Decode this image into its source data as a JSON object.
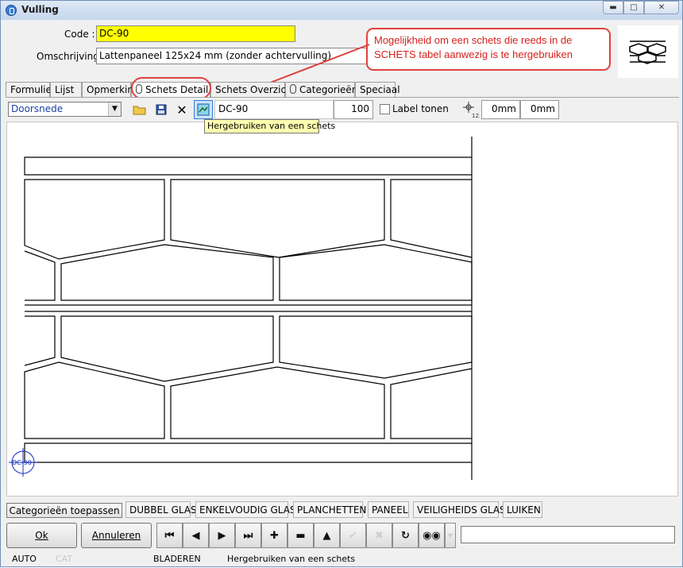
{
  "window": {
    "title": "Vulling"
  },
  "form": {
    "code_label": "Code :",
    "code_value": "DC-90",
    "omschrijving_label": "Omschrijving :",
    "omschrijving_value": "Lattenpaneel 125x24 mm (zonder achtervulling)"
  },
  "callout": {
    "text": "Mogelijkheid om een schets die reeds in de SCHETS tabel aanwezig is te hergebruiken"
  },
  "tabs": [
    {
      "label": "Formulier",
      "icon": ""
    },
    {
      "label": "Lijst",
      "icon": ""
    },
    {
      "label": "Opmerking",
      "icon": ""
    },
    {
      "label": "Schets Detail",
      "icon": "paperclip-icon",
      "active": true
    },
    {
      "label": "Schets Overzicht",
      "icon": ""
    },
    {
      "label": "Categorieën",
      "icon": "paperclip-icon"
    },
    {
      "label": "Speciaal",
      "icon": ""
    }
  ],
  "toolbar": {
    "view_select": "Doorsnede",
    "sketch_name": "DC-90",
    "scale": "100",
    "label_toggle": "Label tonen",
    "offset_x": "0mm",
    "offset_y": "0mm",
    "tooltip": "Hergebruiken van een schets"
  },
  "sketch": {
    "marker_label": "DC-90"
  },
  "categories": {
    "apply_button": "Categorieën toepassen",
    "items": [
      "DUBBEL GLAS",
      "ENKELVOUDIG GLAS",
      "PLANCHETTEN",
      "PANEEL",
      "VEILIGHEIDS GLAS",
      "LUIKEN"
    ]
  },
  "buttons": {
    "ok": "Ok",
    "cancel": "Annuleren"
  },
  "statusbar": {
    "mode": "AUTO",
    "cat": "CAT",
    "state": "BLADEREN",
    "message": "Hergebruiken van een schets"
  },
  "colors": {
    "code_bg": "#ffff00",
    "callout_red": "#d6201c",
    "tooltip_bg": "#ffffb0",
    "combo_text": "#1c3fa7"
  }
}
